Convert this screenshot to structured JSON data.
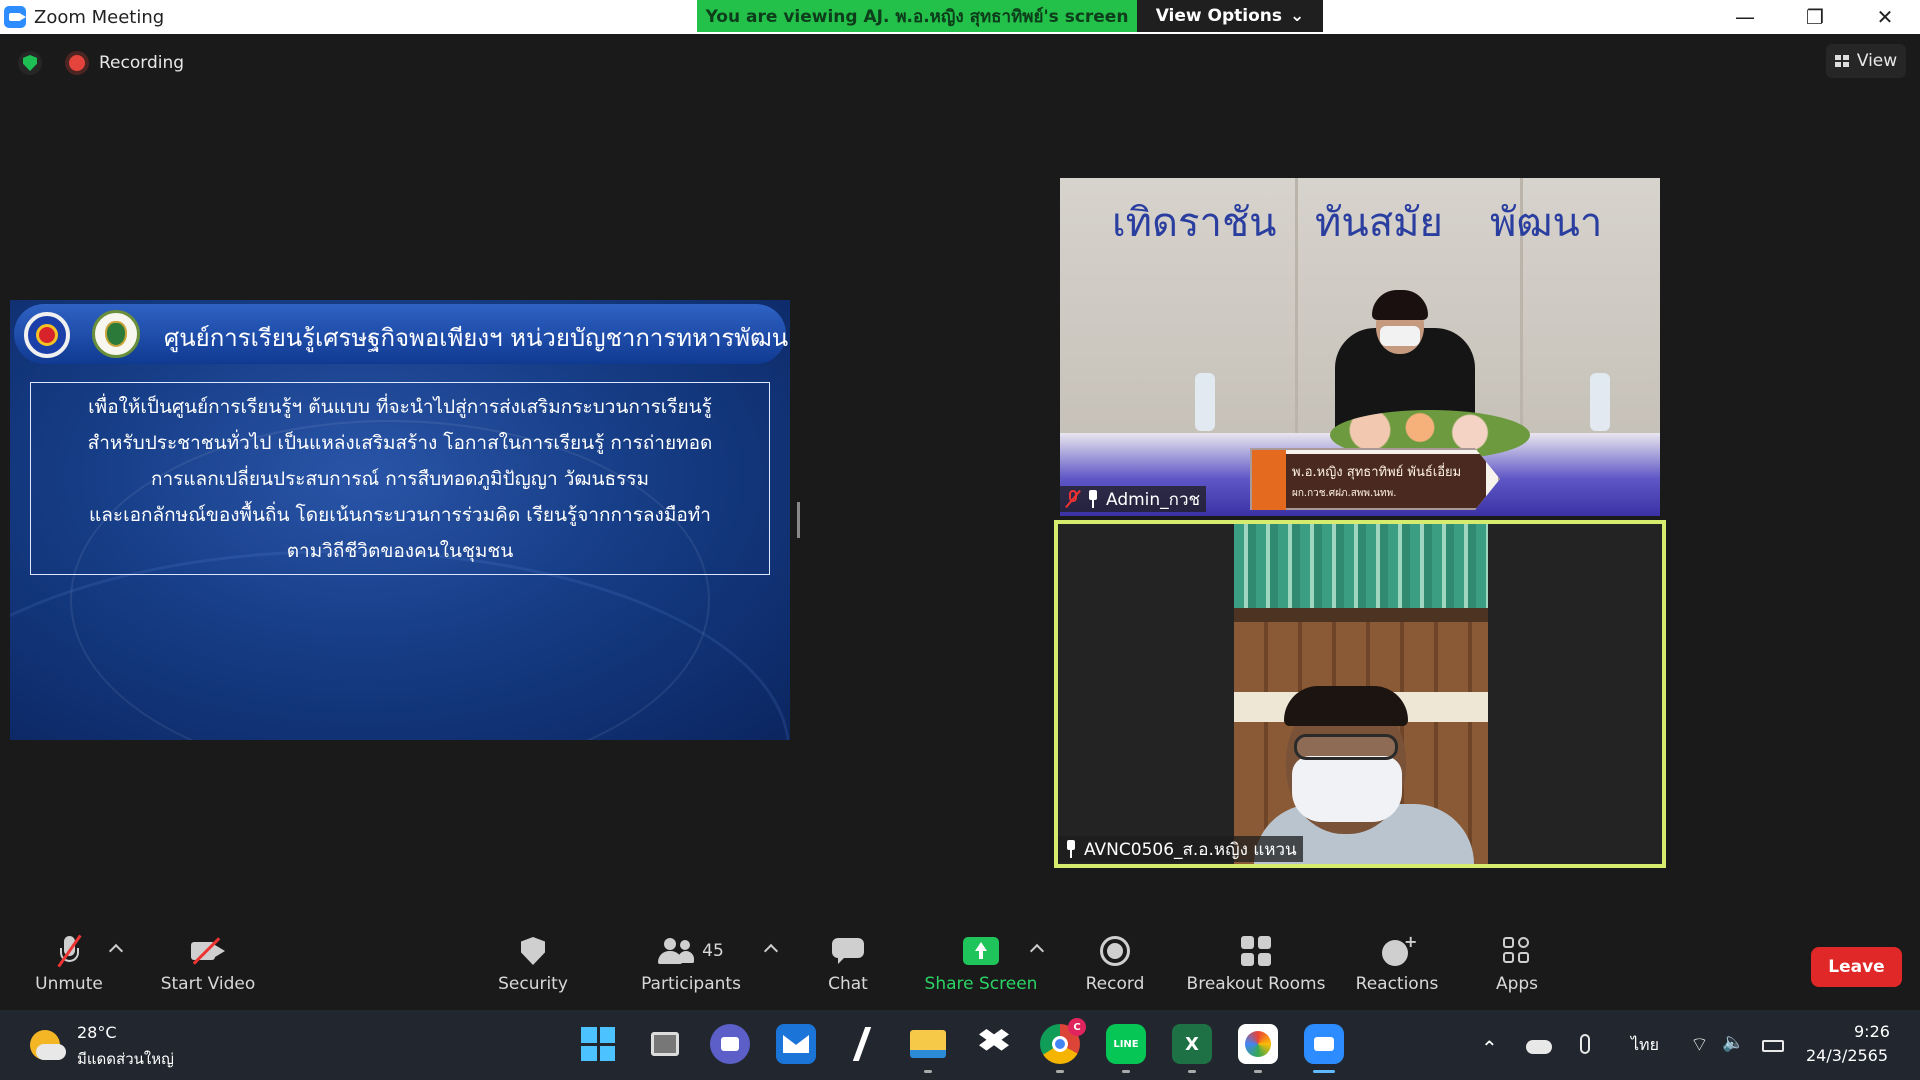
{
  "window": {
    "title": "Zoom Meeting",
    "viewing_banner": "You are viewing AJ. พ.อ.หญิง สุทธาทิพย์'s screen",
    "view_options_label": "View Options",
    "minimize": "—",
    "restore": "❐",
    "close": "✕"
  },
  "meeting_top": {
    "recording_label": "Recording",
    "view_label": "View"
  },
  "slide": {
    "title": "ศูนย์การเรียนรู้เศรษฐกิจพอเพียงฯ หน่วยบัญชาการทหารพัฒนา",
    "lines": [
      "เพื่อให้เป็นศูนย์การเรียนรู้ฯ ต้นแบบ ที่จะนำไปสู่การส่งเสริมกระบวนการเรียนรู้",
      "สำหรับประชาชนทั่วไป เป็นแหล่งเสริมสร้าง โอกาสในการเรียนรู้ การถ่ายทอด",
      "การแลกเปลี่ยนประสบการณ์ การสืบทอดภูมิปัญญา วัฒนธรรม",
      "และเอกลักษณ์ของพื้นถิ่น โดยเน้นกระบวนการร่วมคิด เรียนรู้จากการลงมือทำ",
      "ตามวิถีชีวิตของคนในชุมชน"
    ]
  },
  "participants": [
    {
      "name": "Admin_กวช",
      "muted": true,
      "backdrop_words": [
        "เทิดราชัน",
        "ทันสมัย",
        "พัฒนา"
      ],
      "nameplate_line1": "พ.อ.หญิง สุทธาทิพย์  พันธ์เอี่ยม",
      "nameplate_line2": "ผก.กวช.ศฝภ.สพพ.นทพ."
    },
    {
      "name": "AVNC0506_ส.อ.หญิง แหวน",
      "muted": false,
      "active_speaker": true
    }
  ],
  "toolbar": {
    "unmute": "Unmute",
    "start_video": "Start Video",
    "security": "Security",
    "participants_label": "Participants",
    "participants_count": "45",
    "chat": "Chat",
    "share_screen": "Share Screen",
    "record": "Record",
    "breakout_rooms": "Breakout Rooms",
    "reactions": "Reactions",
    "apps": "Apps",
    "leave": "Leave"
  },
  "taskbar": {
    "temperature": "28°C",
    "weather": "มีแดดส่วนใหญ่",
    "language": "ไทย",
    "time": "9:26",
    "date": "24/3/2565",
    "chrome_badge": "C",
    "excel_letter": "X",
    "line_label": "LINE"
  },
  "colors": {
    "banner_green": "#23c04a",
    "active_speaker_border": "#d6ec6e",
    "leave_red": "#e02828",
    "share_green": "#1fc45a"
  }
}
